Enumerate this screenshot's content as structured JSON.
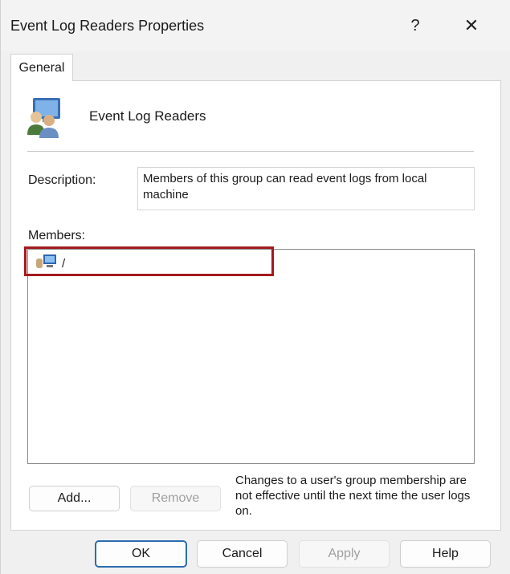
{
  "window": {
    "title": "Event Log Readers Properties",
    "help_glyph": "?",
    "close_glyph": "✕"
  },
  "tabs": [
    {
      "label": "General",
      "active": true
    }
  ],
  "general": {
    "group_name": "Event Log Readers",
    "group_icon": "user-group-icon",
    "description_label": "Description:",
    "description_value": "Members of this group can read event logs from local machine",
    "members_label": "Members:",
    "members": [
      {
        "name": "/",
        "icon": "computer-user-icon"
      }
    ],
    "add_label": "Add...",
    "remove_label": "Remove",
    "membership_note": "Changes to a user's group membership are not effective until the next time the user logs on."
  },
  "footer": {
    "ok_label": "OK",
    "cancel_label": "Cancel",
    "apply_label": "Apply",
    "help_label": "Help"
  },
  "colors": {
    "highlight": "#a31a1f",
    "default_button_border": "#2d6cb0"
  }
}
